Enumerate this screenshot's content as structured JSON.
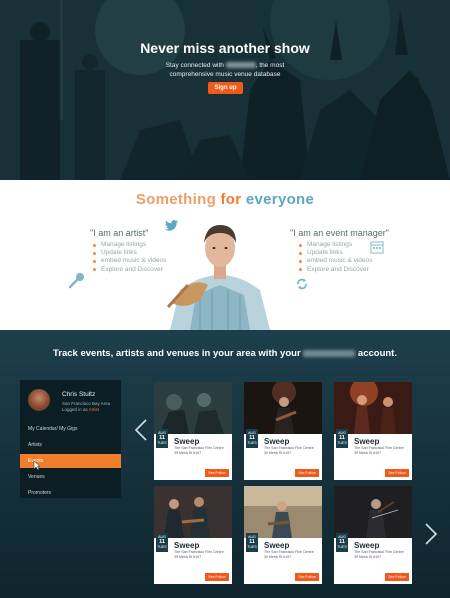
{
  "hero": {
    "title": "Never miss another show",
    "subtitle_line1": "Stay connected with",
    "subtitle_line1_end": ", the most",
    "subtitle_line2": "comprehensive music venue database",
    "signup_label": "Sign up"
  },
  "features": {
    "heading_word1": "Something",
    "heading_word2": "for",
    "heading_word3": "everyone",
    "artist": {
      "title": "\"I am an artist\"",
      "items": [
        "Manage listings",
        "Update links",
        "embed music & videos",
        "Explore and Discover"
      ]
    },
    "manager": {
      "title": "\"I am an event manager\"",
      "items": [
        "Manage listings",
        "Update links",
        "embed music & videos",
        "Explore and Discover"
      ]
    }
  },
  "track": {
    "title_start": "Track events, artists and venues in your area with your",
    "title_end": "account."
  },
  "sidebar": {
    "user_name": "Chris Stultz",
    "location": "San Francisco Bay Area",
    "logged_in_prefix": "Logged in as",
    "role": "Artist",
    "items": [
      {
        "label": "My Calendar/ My Gigs",
        "active": false
      },
      {
        "label": "Artists",
        "active": false
      },
      {
        "label": "Events",
        "active": true
      },
      {
        "label": "Venues",
        "active": false
      },
      {
        "label": "Promoters",
        "active": false
      }
    ]
  },
  "events": [
    {
      "title": "Sweep",
      "month": "AUG",
      "day": "11",
      "weekday": "TUES",
      "venue": "The San Francisco Film Centre",
      "address": "39 Mesa St #107",
      "follow_label": "See Follow"
    },
    {
      "title": "Sweep",
      "month": "AUG",
      "day": "11",
      "weekday": "TUES",
      "venue": "The San Francisco Film Centre",
      "address": "39 Mesa St #107",
      "follow_label": "See Follow"
    },
    {
      "title": "Sweep",
      "month": "AUG",
      "day": "11",
      "weekday": "TUES",
      "venue": "The San Francisco Film Centre",
      "address": "39 Mesa St #107",
      "follow_label": "See Follow"
    },
    {
      "title": "Sweep",
      "month": "AUG",
      "day": "11",
      "weekday": "TUES",
      "venue": "The San Francisco Film Centre",
      "address": "39 Mesa St #107",
      "follow_label": "See Follow"
    },
    {
      "title": "Sweep",
      "month": "AUG",
      "day": "11",
      "weekday": "TUES",
      "venue": "The San Francisco Film Centre",
      "address": "39 Mesa St #107",
      "follow_label": "See Follow"
    },
    {
      "title": "Sweep",
      "month": "AUG",
      "day": "11",
      "weekday": "TUES",
      "venue": "The San Francisco Film Centre",
      "address": "39 Mesa St #107",
      "follow_label": "See Follow"
    }
  ],
  "colors": {
    "accent": "#f05a1a",
    "teal_dark": "#1a3e4a",
    "heading_blue": "#5aa8c4"
  },
  "icons": [
    "twitter-icon",
    "microphone-icon",
    "calendar-icon",
    "refresh-icon",
    "chevron-left-icon",
    "chevron-right-icon"
  ]
}
